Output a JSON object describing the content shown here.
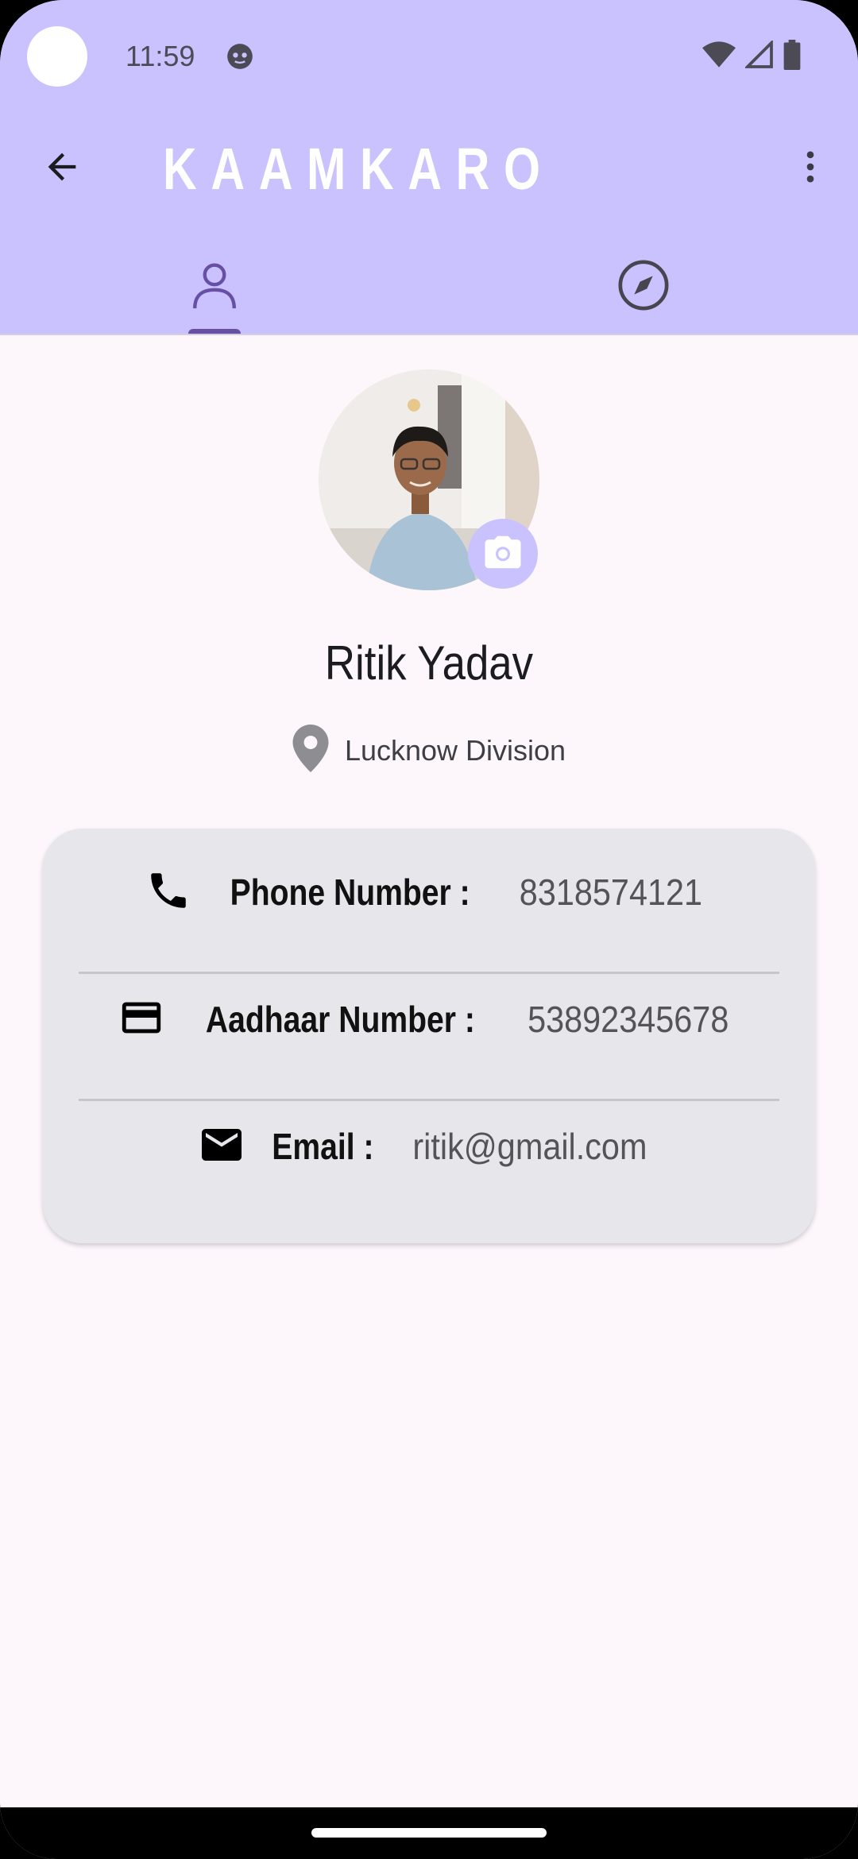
{
  "status_bar": {
    "time": "11:59",
    "icons": [
      "notification-icon",
      "wifi-icon",
      "cellular-icon",
      "battery-icon"
    ]
  },
  "toolbar": {
    "title": "KAAMKARO",
    "back_icon": "arrow-back-icon",
    "menu_icon": "more-vert-icon"
  },
  "tabs": [
    {
      "icon": "person-icon",
      "selected": true
    },
    {
      "icon": "compass-icon",
      "selected": false
    }
  ],
  "profile": {
    "name": "Ritik Yadav",
    "location": "Lucknow Division",
    "avatar_icon": "profile-photo",
    "camera_icon": "camera-icon"
  },
  "info": {
    "phone_label": "Phone Number :",
    "phone_value": "8318574121",
    "aadhaar_label": "Aadhaar Number :",
    "aadhaar_value": "53892345678",
    "email_label": "Email :",
    "email_value": "ritik@gmail.com"
  },
  "colors": {
    "app_bar": "#c9c2fe",
    "accent": "#6750a4",
    "background": "#fdf7fc",
    "card": "#e7e6ea"
  }
}
